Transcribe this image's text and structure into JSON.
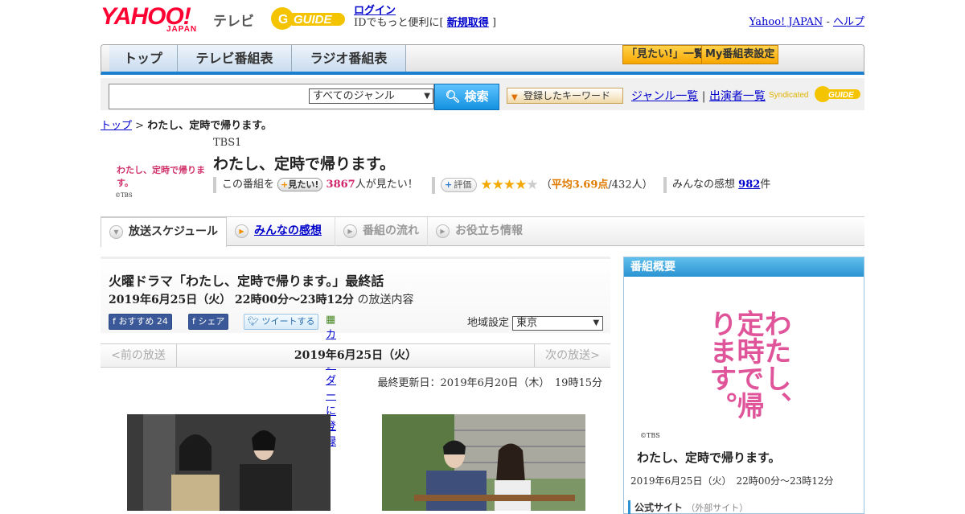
{
  "header": {
    "yahoo_logo": "YAHOO!",
    "japan_logo": "JAPAN",
    "service_name": "テレビ",
    "gguide_logo": "GUIDE",
    "login_link": "ログイン",
    "login_text": "IDでもっと便利に[",
    "signup_link": "新規取得",
    "login_close": "]",
    "yahoo_japan_link": "Yahoo! JAPAN",
    "separator": "-",
    "help_link": "ヘルプ"
  },
  "nav": {
    "tabs": [
      "トップ",
      "テレビ番組表",
      "ラジオ番組表"
    ],
    "mitai_list": "「見たい!」一覧",
    "my_schedule": "My番組表設定"
  },
  "search": {
    "query": "",
    "genre": "すべてのジャンル",
    "search_button": "検索",
    "keyword_button": "登録したキーワード",
    "genre_list_link": "ジャンル一覧",
    "divider": "|",
    "cast_list_link": "出演者一覧",
    "syndicated": "Syndicated"
  },
  "breadcrumb": {
    "top": "トップ",
    "sep": " > ",
    "current": "わたし、定時で帰ります。"
  },
  "program": {
    "thumb_title": "わたし、定時で帰ります。",
    "thumb_copyright": "©TBS",
    "channel": "TBS1",
    "title": "わたし、定時で帰ります。",
    "mitai_prefix": "この番組を",
    "mitai_button": "見たい!",
    "mitai_count": "3867",
    "mitai_suffix": "人が見たい！",
    "hyoka_button": "評価",
    "rating_text_open": "（",
    "rating_avg": "平均3.69点",
    "rating_count": "/432人）",
    "impressions_prefix": "みんなの感想",
    "impressions_count": "982",
    "impressions_suffix": "件"
  },
  "tabs": {
    "schedule": "放送スケジュール",
    "impressions": "みんなの感想",
    "flow": "番組の流れ",
    "info": "お役立ち情報"
  },
  "episode": {
    "title": "火曜ドラマ「わたし、定時で帰ります。」最終話",
    "date_bold": "2019年6月25日（火）  22時00分～23時12分",
    "date_suffix": "の放送内容",
    "fb_recommend": "おすすめ 24",
    "fb_share": "シェア",
    "tweet": "ツイートする",
    "calendar": "カレンダーに登録",
    "region_label": "地域設定",
    "region_value": "東京",
    "prev": "<前の放送",
    "current_date": "2019年6月25日（火）",
    "next": "次の放送>",
    "updated": "最終更新日：2019年6月20日（木）　19時15分"
  },
  "sidebar": {
    "heading": "番組概要",
    "poster_text": "わたし、定時で帰ります。",
    "poster_copyright": "©TBS",
    "title": "わたし、定時で帰ります。",
    "time": "2019年6月25日（火）　22時00分～23時12分",
    "official": "公式サイト",
    "official_note": "（外部サイト）"
  },
  "colors": {
    "accent_blue": "#1a7fce",
    "pink": "#d0246a",
    "orange": "#e07a00",
    "yahoo_red": "#ff0033"
  }
}
